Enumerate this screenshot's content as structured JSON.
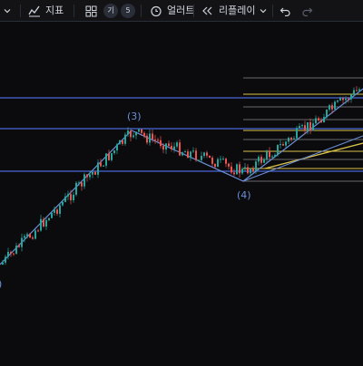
{
  "toolbar": {
    "indicators_label": "지표",
    "alerts_label": "얼러트",
    "replay_label": "리플레이",
    "pill_left": "기",
    "pill_right": "5"
  },
  "wave_labels": {
    "wave3": "(3)",
    "wave4": "(4)"
  },
  "colors": {
    "background": "#0b0b0e",
    "bull_candle": "#26a69a",
    "bear_candle": "#ef5350",
    "horizontal_lines": "#4a67d6",
    "wave_lines": "#6b8fd6",
    "fib_lines": "#d9c24a",
    "fib_box_lines": "#8a8a8a"
  }
}
